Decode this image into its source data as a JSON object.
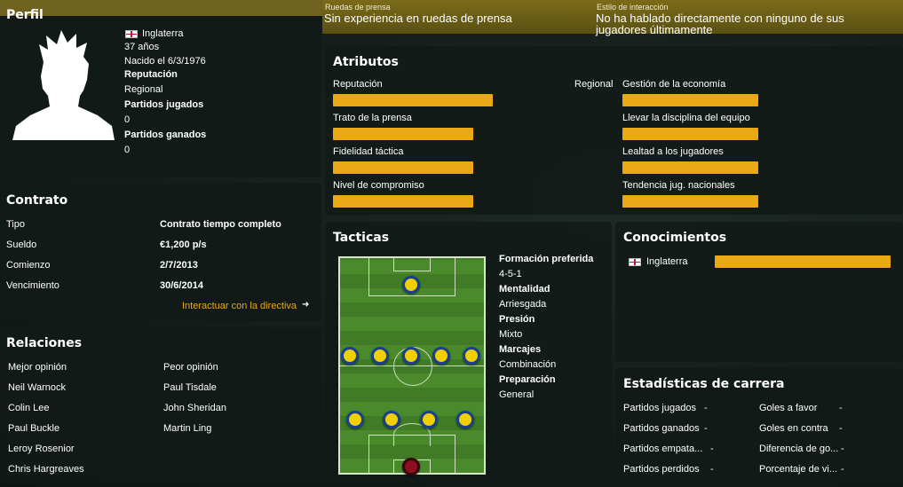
{
  "top": {
    "perfil_title": "Perfil",
    "press_label": "Ruedas de prensa",
    "press_value": "Sin experiencia en ruedas de prensa",
    "interaction_label": "Estilo de interacción",
    "interaction_value_1": "No ha hablado directamente con ninguno de sus",
    "interaction_value_2": "jugadores últimamente"
  },
  "profile": {
    "nation": "Inglaterra",
    "age": "37 años",
    "born": "Nacido el 6/3/1976",
    "reputation_label": "Reputación",
    "reputation_value": "Regional",
    "played_label": "Partidos jugados",
    "played_value": "0",
    "won_label": "Partidos ganados",
    "won_value": "0"
  },
  "contract": {
    "title": "Contrato",
    "rows": [
      {
        "label": "Tipo",
        "value": "Contrato tiempo completo"
      },
      {
        "label": "Sueldo",
        "value": "€1,200 p/s"
      },
      {
        "label": "Comienzo",
        "value": "2/7/2013"
      },
      {
        "label": "Vencimiento",
        "value": "30/6/2014"
      }
    ],
    "link": "Interactuar con la directiva"
  },
  "relations": {
    "title": "Relaciones",
    "best_label": "Mejor opinión",
    "worst_label": "Peor opinión",
    "best": [
      "Neil Warnock",
      "Colin Lee",
      "Paul Buckle",
      "Leroy Rosenior",
      "Chris Hargreaves"
    ],
    "worst": [
      "Paul Tisdale",
      "John Sheridan",
      "Martin Ling"
    ]
  },
  "attributes": {
    "title": "Atributos",
    "rep_label": "Reputación",
    "rep_value": "Regional",
    "left": [
      {
        "label": "Trato de la prensa",
        "level": 0.58
      },
      {
        "label": "Fidelidad táctica",
        "level": 0.58
      },
      {
        "label": "Nivel de compromiso",
        "level": 0.58
      }
    ],
    "rep_level": 0.66,
    "right": [
      {
        "label": "Gestión de la economía",
        "level": 0.55
      },
      {
        "label": "Llevar la disciplina del equipo",
        "level": 0.55
      },
      {
        "label": "Lealtad a los jugadores",
        "level": 0.55
      },
      {
        "label": "Tendencia jug. nacionales",
        "level": 0.55
      }
    ]
  },
  "tactics": {
    "title": "Tacticas",
    "formation_label": "Formación preferida",
    "formation_value": "4-5-1",
    "mentality_label": "Mentalidad",
    "mentality_value": "Arriesgada",
    "pressure_label": "Presión",
    "pressure_value": "Mixto",
    "marking_label": "Marcajes",
    "marking_value": "Combinación",
    "prep_label": "Preparación",
    "prep_value": "General"
  },
  "knowledge": {
    "title": "Conocimientos",
    "nation": "Inglaterra",
    "level": 1.0
  },
  "career": {
    "title": "Estadísticas de carrera",
    "left": [
      {
        "label": "Partidos jugados",
        "value": "-"
      },
      {
        "label": "Partidos ganados",
        "value": "-"
      },
      {
        "label": "Partidos empata...",
        "value": "-"
      },
      {
        "label": "Partidos perdidos",
        "value": "-"
      }
    ],
    "right": [
      {
        "label": "Goles a favor",
        "value": "-"
      },
      {
        "label": "Goles en contra",
        "value": "-"
      },
      {
        "label": "Diferencia de go...",
        "value": "-"
      },
      {
        "label": "Porcentaje de vi...",
        "value": "-"
      }
    ]
  },
  "colors": {
    "accent": "#eaa814",
    "panel": "#121a18",
    "header_bar": "#6f6220"
  }
}
